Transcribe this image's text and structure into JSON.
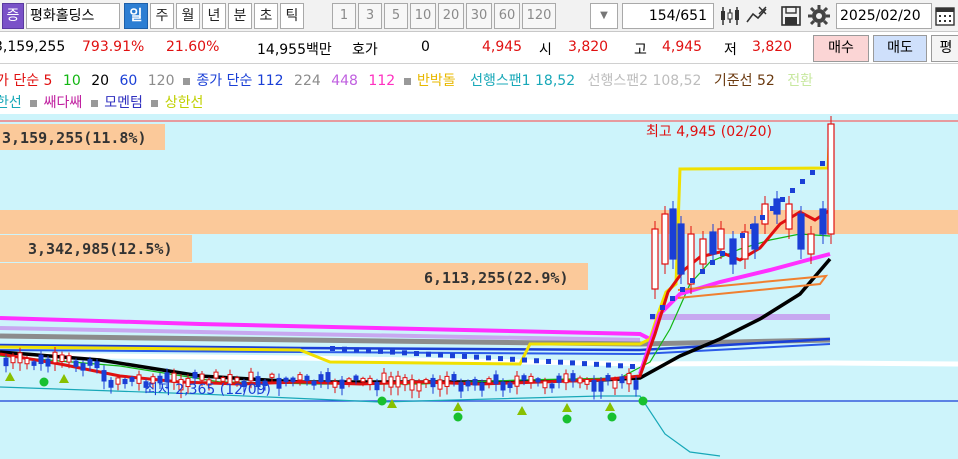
{
  "toolbar": {
    "market_badge": "증",
    "stock_name": "평화홀딩스",
    "periods": [
      "일",
      "주",
      "월",
      "년",
      "분",
      "초",
      "틱"
    ],
    "active_period": "일",
    "intervals": [
      "1",
      "3",
      "5",
      "10",
      "20",
      "30",
      "60",
      "120"
    ],
    "counter": "154/651",
    "date": "2025/02/20",
    "icons": [
      "candle-compare-icon",
      "zoom-lines-icon",
      "save-disk-icon",
      "gear-icon",
      "calendar-icon"
    ]
  },
  "quote": {
    "volume": "3,159,255",
    "volume_ratio": "793.91%",
    "change_rate": "21.60%",
    "amount": "14,955백만",
    "hoga_label": "호가",
    "hoga_value": "0",
    "last_price": "4,945",
    "open_label": "시",
    "open": "3,820",
    "high_label": "고",
    "high": "4,945",
    "low_label": "저",
    "low": "3,820",
    "buy_button": "매수",
    "sell_button": "매도",
    "extra_button": "평"
  },
  "legend": {
    "price_ma_label": "가 단순",
    "price_ma": [
      {
        "label": "5",
        "color": "#e01010"
      },
      {
        "label": "10",
        "color": "#12b612"
      },
      {
        "label": "20",
        "color": "#000000"
      },
      {
        "label": "60",
        "color": "#1a3fd6"
      },
      {
        "label": "120",
        "color": "#8c8c8c"
      }
    ],
    "close_ma_label": "종가 단순",
    "close_ma": [
      {
        "label": "112",
        "color": "#1a3fd6"
      },
      {
        "label": "224",
        "color": "#8c8c8c"
      },
      {
        "label": "448",
        "color": "#c060e0"
      },
      {
        "label": "112",
        "color": "#ff30c0"
      }
    ],
    "items": [
      {
        "label": "반박돌",
        "color": "#e8b800"
      },
      {
        "label": "선행스팬1 18,52",
        "color": "#18a8b8"
      },
      {
        "label": "선행스팬2 108,52",
        "color": "#a8a8a8"
      },
      {
        "label": "기준선 52",
        "color": "#6b3a10"
      },
      {
        "label": "전환",
        "color": "#c8e8a0"
      }
    ],
    "row2": [
      {
        "label": "한선",
        "color": "#18a8b8"
      },
      {
        "label": "쌔다쌔",
        "color": "#c020a0"
      },
      {
        "label": "모멘텀",
        "color": "#3030c0"
      },
      {
        "label": "상한선",
        "color": "#c0d000"
      }
    ]
  },
  "chart": {
    "volume_bands": [
      {
        "label": "3,159,255(11.8%)"
      },
      {
        "label": "3,342,985(12.5%)"
      },
      {
        "label": "6,113,255(22.9%)"
      }
    ],
    "high_annotation": "최고 4,945 (02/20)",
    "low_annotation": "최저 2,365 (12/09)",
    "colors": {
      "background": "#cdf4fb",
      "volume_band": "#fbc99a",
      "up_candle": "#e01010",
      "down_candle": "#1a3fd6",
      "ma5": "#e01010",
      "ma10": "#12b612",
      "ma20": "#000000",
      "ma60": "#1a3fd6",
      "ma120": "#8c8c8c",
      "envelope": "#ff30ff",
      "span_top": "#c7a8f0"
    }
  }
}
